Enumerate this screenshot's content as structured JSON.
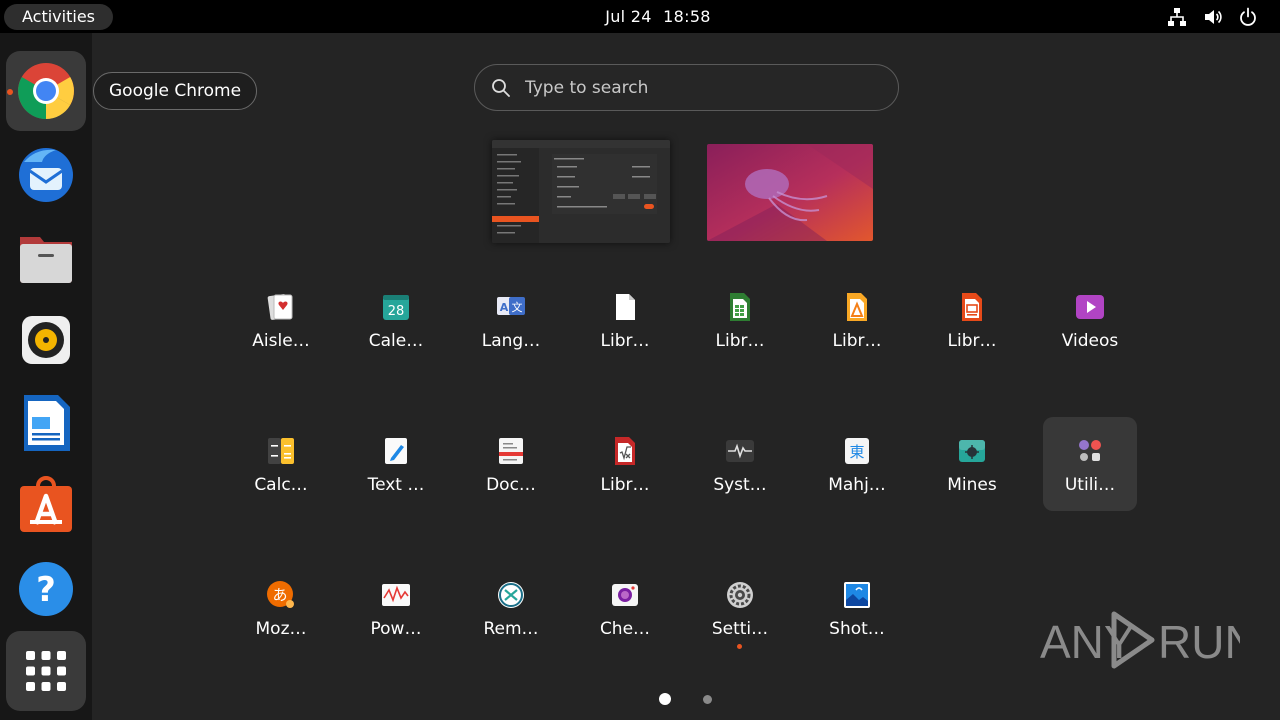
{
  "topbar": {
    "activities": "Activities",
    "date": "Jul 24",
    "time": "18:58",
    "tray_icons": [
      "network-icon",
      "volume-icon",
      "power-icon"
    ]
  },
  "dock": {
    "items": [
      {
        "name": "Google Chrome",
        "icon": "chrome-icon",
        "active": true
      },
      {
        "name": "Thunderbird",
        "icon": "thunderbird-icon"
      },
      {
        "name": "Files",
        "icon": "files-icon"
      },
      {
        "name": "Rhythmbox",
        "icon": "rhythmbox-icon"
      },
      {
        "name": "LibreOffice Writer",
        "icon": "writer-icon"
      },
      {
        "name": "Ubuntu Software",
        "icon": "software-icon"
      },
      {
        "name": "Help",
        "icon": "help-icon"
      },
      {
        "name": "Show Applications",
        "icon": "app-grid-icon"
      }
    ],
    "tooltip": "Google Chrome"
  },
  "search": {
    "placeholder": "Type to search"
  },
  "apps": [
    {
      "label": "Aisle…",
      "icon": "aisleriot-icon"
    },
    {
      "label": "Cale…",
      "icon": "calendar-icon",
      "icon_text": "28"
    },
    {
      "label": "Lang…",
      "icon": "language-icon"
    },
    {
      "label": "Libr…",
      "icon": "libreoffice-icon"
    },
    {
      "label": "Libr…",
      "icon": "libreoffice-calc-icon"
    },
    {
      "label": "Libr…",
      "icon": "libreoffice-draw-icon"
    },
    {
      "label": "Libr…",
      "icon": "libreoffice-impress-icon"
    },
    {
      "label": "Videos",
      "icon": "videos-icon"
    },
    {
      "label": "Calc…",
      "icon": "calculator-icon"
    },
    {
      "label": "Text …",
      "icon": "text-editor-icon"
    },
    {
      "label": "Doc…",
      "icon": "document-viewer-icon"
    },
    {
      "label": "Libr…",
      "icon": "libreoffice-math-icon"
    },
    {
      "label": "Syst…",
      "icon": "system-monitor-icon"
    },
    {
      "label": "Mahj…",
      "icon": "mahjongg-icon",
      "icon_text": "東"
    },
    {
      "label": "Mines",
      "icon": "mines-icon"
    },
    {
      "label": "Utili…",
      "icon": "utilities-folder-icon",
      "hover": true
    },
    {
      "label": "Moz…",
      "icon": "mozc-icon",
      "icon_text": "あ"
    },
    {
      "label": "Pow…",
      "icon": "power-statistics-icon"
    },
    {
      "label": "Rem…",
      "icon": "remmina-icon"
    },
    {
      "label": "Che…",
      "icon": "cheese-icon"
    },
    {
      "label": "Setti…",
      "icon": "settings-icon",
      "running": true
    },
    {
      "label": "Shot…",
      "icon": "shotwell-icon"
    }
  ],
  "pagination": {
    "pages": 2,
    "current": 1
  },
  "watermark": {
    "text_left": "ANY",
    "text_right": "RUN"
  }
}
